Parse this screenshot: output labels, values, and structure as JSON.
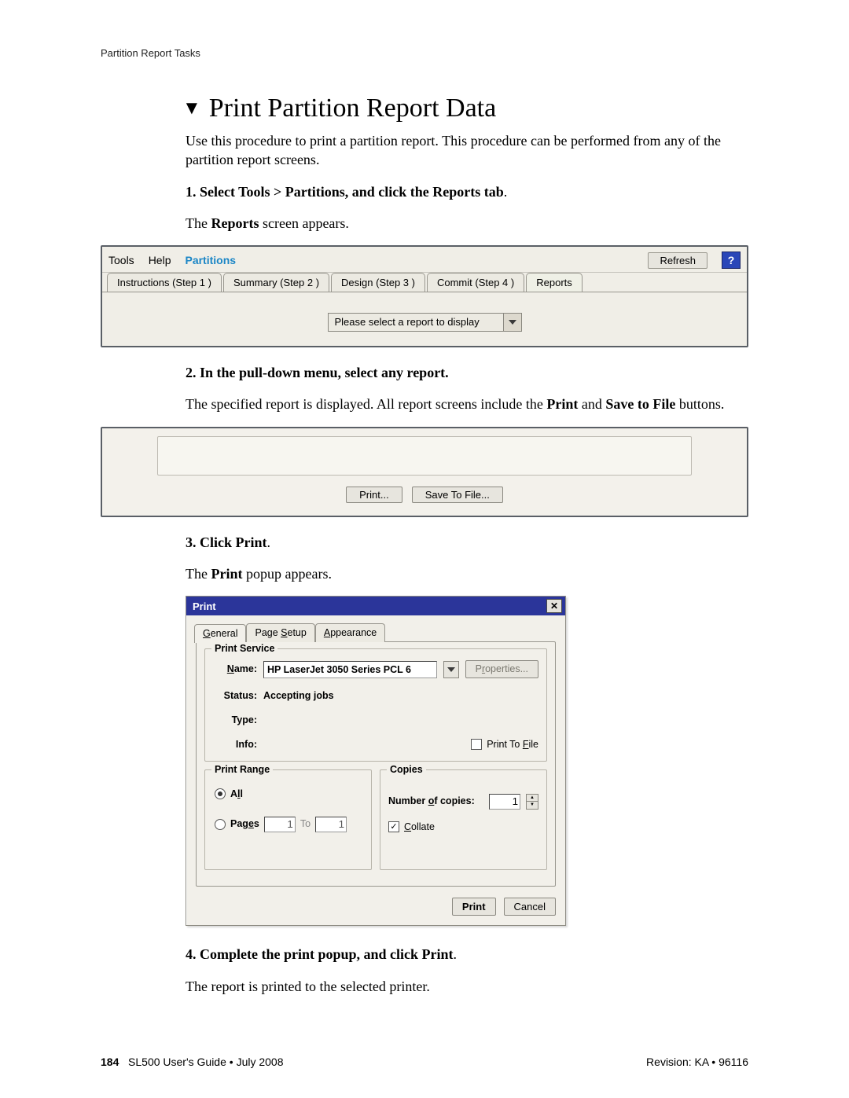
{
  "running_head": "Partition Report Tasks",
  "title": "Print Partition Report Data",
  "intro": "Use this procedure to print a partition report. This procedure can be performed from any of the partition report screens.",
  "step1": {
    "num": "1.",
    "bold_a": "Select Tools > Partitions, and click the Reports tab",
    "period": ".",
    "after_a": "The ",
    "bold_b": "Reports",
    "after_b": " screen appears."
  },
  "shot1": {
    "menu_tools": "Tools",
    "menu_help": "Help",
    "menu_partitions": "Partitions",
    "refresh": "Refresh",
    "help_q": "?",
    "tabs": {
      "instructions": "Instructions (Step 1 )",
      "summary": "Summary (Step 2 )",
      "design": "Design (Step 3 )",
      "commit": "Commit (Step 4 )",
      "reports": "Reports"
    },
    "combo_label": "Please select a report to display"
  },
  "step2": {
    "num": "2.",
    "bold": "In the pull-down menu, select any report.",
    "line_a": "The specified report is displayed. All report screens include the ",
    "b1": "Print",
    "mid": " and ",
    "b2": "Save to File",
    "end": " buttons."
  },
  "shot2": {
    "print": "Print...",
    "save": "Save To File..."
  },
  "step3": {
    "num": "3.",
    "bold": "Click Print",
    "period": ".",
    "line_a": "The ",
    "b1": "Print",
    "line_b": " popup appears."
  },
  "print_dialog": {
    "title": "Print",
    "tabs": {
      "general": "General",
      "page_setup": "Page Setup",
      "appearance": "Appearance"
    },
    "svc_group": "Print Service",
    "lbl_name": "Name:",
    "name_value": "HP LaserJet 3050 Series PCL 6",
    "properties": "Properties...",
    "lbl_status": "Status:",
    "status_value": "Accepting jobs",
    "lbl_type": "Type:",
    "lbl_info": "Info:",
    "print_to_file": "Print To File",
    "range_group": "Print Range",
    "range_all": "All",
    "range_pages": "Pages",
    "range_from": "1",
    "range_to_lbl": "To",
    "range_to": "1",
    "copies_group": "Copies",
    "lbl_copies": "Number of copies:",
    "copies_value": "1",
    "collate": "Collate",
    "btn_print": "Print",
    "btn_cancel": "Cancel"
  },
  "step4": {
    "num": "4.",
    "bold": "Complete the print popup, and click Print",
    "period": ".",
    "line": "The report is printed to the selected printer."
  },
  "footer": {
    "page_no": "184",
    "left_rest": "SL500 User's Guide  •  July 2008",
    "right": "Revision: KA  •  96116"
  }
}
